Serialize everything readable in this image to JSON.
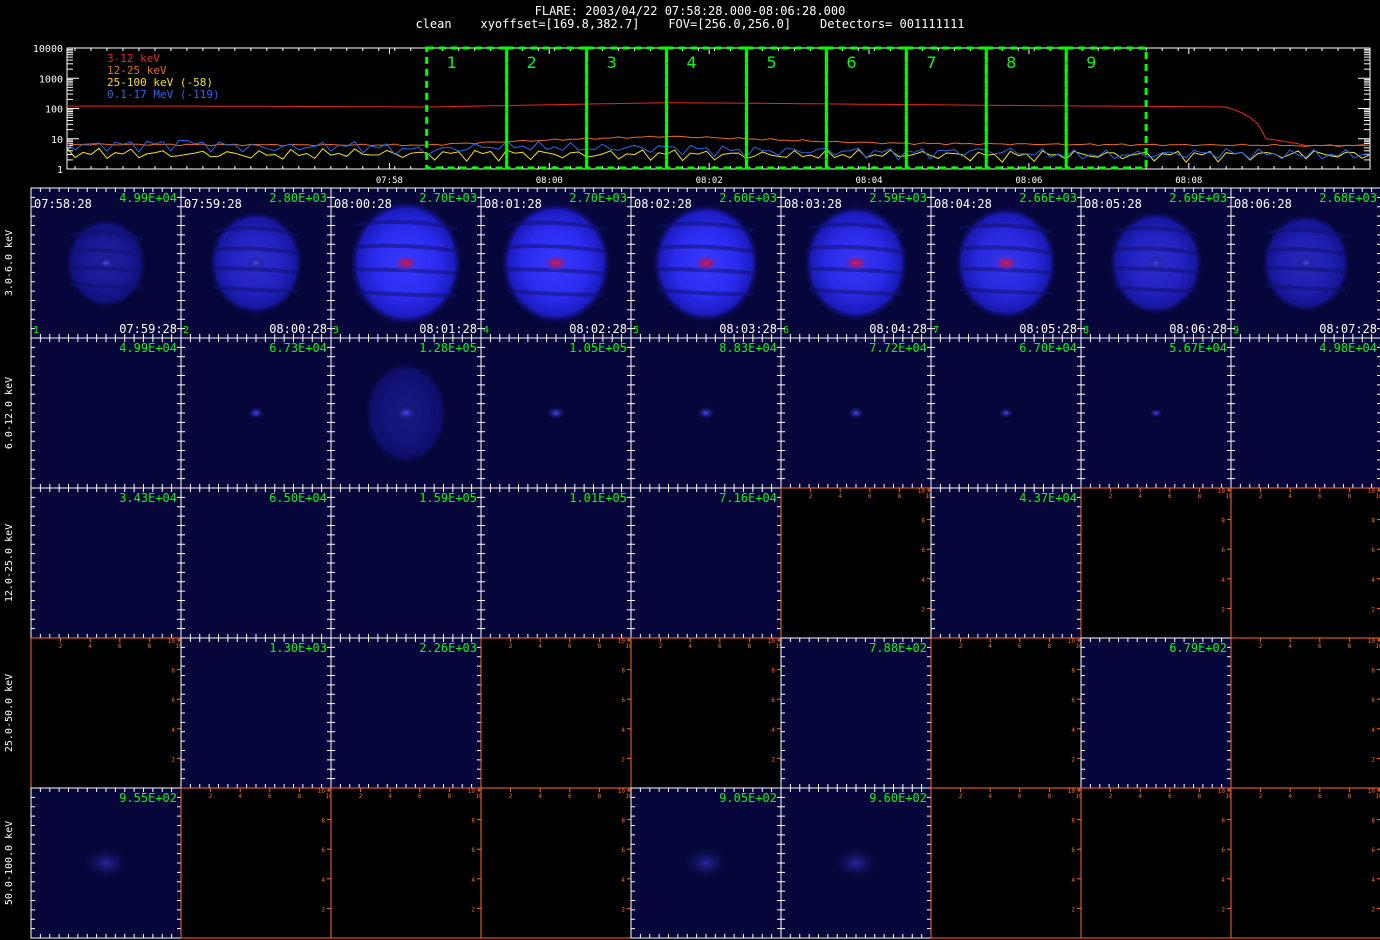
{
  "title": {
    "line1": "FLARE: 2003/04/22 07:58:28.000-08:06:28.000",
    "line2": "clean    xyoffset=[169.8,382.7]    FOV=[256.0,256.0]    Detectors= 001111111"
  },
  "colors": {
    "lc_3_12": "#e8281e",
    "lc_12_25": "#e86a1e",
    "lc_25_100": "#f0e020",
    "lc_01_17": "#2868f0",
    "interval_box": "#00ff00",
    "counts_label": "#00ff00",
    "empty_axis": "#ff6a28",
    "image_base": "#06063a"
  },
  "chart_data": [
    {
      "type": "line",
      "name": "lightcurve",
      "yscale": "log",
      "ylim": [
        1,
        10000
      ],
      "yticks": [
        "10000",
        "1000",
        "100",
        "10",
        "1"
      ],
      "xticks": [
        {
          "t": 7.967,
          "label": "07:58"
        },
        {
          "t": 8.0,
          "label": "08:00"
        },
        {
          "t": 8.033,
          "label": "08:02"
        },
        {
          "t": 8.067,
          "label": "08:04"
        },
        {
          "t": 8.1,
          "label": "08:06"
        },
        {
          "t": 8.133,
          "label": "08:08"
        }
      ],
      "xlim_minutes": [
        -4.5,
        11.8
      ],
      "x_unit_note": "minutes after 07:58:28",
      "series": [
        {
          "name": "3-12 keV",
          "x": [
            -4.5,
            -3,
            -2,
            0,
            1,
            2,
            3,
            4,
            5,
            6,
            7,
            8,
            9,
            10,
            10.5,
            11,
            11.8
          ],
          "values": [
            120,
            120,
            118,
            112,
            125,
            140,
            155,
            150,
            142,
            135,
            128,
            122,
            118,
            112,
            10,
            6,
            6
          ]
        },
        {
          "name": "12-25 keV",
          "x": [
            -4.5,
            -2,
            0,
            1,
            2,
            3,
            4,
            5,
            6,
            7,
            8,
            9,
            10,
            11,
            11.8
          ],
          "values": [
            6.5,
            6.3,
            6.2,
            8,
            10,
            12,
            10,
            8,
            7,
            6.8,
            6.5,
            6.3,
            6.2,
            6,
            6
          ]
        },
        {
          "name": "25-100 keV (-58)",
          "x": [
            -4.5,
            -3,
            -2,
            -1,
            0,
            1,
            2,
            3,
            4,
            5,
            6,
            7,
            8,
            9,
            10,
            11,
            11.8
          ],
          "values": [
            3.5,
            3.2,
            3.0,
            3.4,
            3.1,
            3.3,
            3.0,
            3.2,
            2.9,
            3.0,
            3.1,
            2.8,
            3.0,
            2.9,
            3.0,
            3.1,
            3.0
          ]
        },
        {
          "name": "0.1-17 MeV (-119)",
          "x": [
            -4.5,
            -3,
            -2,
            -1,
            0,
            1,
            2,
            3,
            4,
            5,
            6,
            7,
            8,
            9,
            10,
            11,
            11.8
          ],
          "values": [
            6,
            7,
            5,
            6,
            4,
            6,
            5,
            5,
            4,
            4,
            3.5,
            4,
            3,
            3,
            3.5,
            3,
            3.2
          ]
        }
      ],
      "intervals": [
        "1",
        "2",
        "3",
        "4",
        "5",
        "6",
        "7",
        "8",
        "9"
      ]
    },
    {
      "type": "heatmap",
      "name": "image_grid",
      "energy_bands": [
        "3.0-6.0 keV",
        "6.0-12.0 keV",
        "12.0-25.0 keV",
        "25.0-50.0 keV",
        "50.0-100.0 keV"
      ],
      "interval_numbers": [
        "1",
        "2",
        "3",
        "4",
        "5",
        "6",
        "7",
        "8",
        "9"
      ],
      "start_times": [
        "07:58:28",
        "07:59:28",
        "08:00:28",
        "08:01:28",
        "08:02:28",
        "08:03:28",
        "08:04:28",
        "08:05:28",
        "08:06:28"
      ],
      "end_times": [
        "07:59:28",
        "08:00:28",
        "08:01:28",
        "08:02:28",
        "08:03:28",
        "08:04:28",
        "08:05:28",
        "08:06:28",
        "08:07:28"
      ],
      "counts": [
        [
          "4.99E+04",
          "2.80E+03",
          "2.70E+03",
          "2.70E+03",
          "2.60E+03",
          "2.59E+03",
          "2.66E+03",
          "2.69E+03",
          "2.68E+03"
        ],
        [
          "4.99E+04",
          "6.73E+04",
          "1.28E+05",
          "1.05E+05",
          "8.83E+04",
          "7.72E+04",
          "6.70E+04",
          "5.67E+04",
          "4.98E+04"
        ],
        [
          "3.43E+04",
          "6.50E+04",
          "1.59E+05",
          "1.01E+05",
          "7.16E+04",
          "",
          "4.37E+04",
          "",
          ""
        ],
        [
          "",
          "1.30E+03",
          "2.26E+03",
          "",
          "",
          "7.88E+02",
          "",
          "6.79E+02",
          ""
        ],
        [
          "9.55E+02",
          "",
          "",
          "",
          "9.05E+02",
          "9.60E+02",
          "",
          "",
          ""
        ]
      ],
      "source_intensity": [
        [
          0.35,
          0.6,
          0.95,
          0.9,
          0.85,
          0.8,
          0.75,
          0.6,
          0.5
        ],
        [
          0,
          0.45,
          0.8,
          0.55,
          0.5,
          0.4,
          0.25,
          0.15,
          0
        ],
        [
          0,
          0,
          0,
          0,
          0,
          0,
          0,
          0,
          0
        ],
        [
          0,
          0,
          0,
          0,
          0,
          0,
          0,
          0,
          0
        ],
        [
          0.08,
          0,
          0,
          0,
          0.06,
          0.05,
          0,
          0,
          0
        ]
      ],
      "empty_axis_ticks": [
        "2",
        "4",
        "6",
        "8",
        "10"
      ]
    }
  ]
}
